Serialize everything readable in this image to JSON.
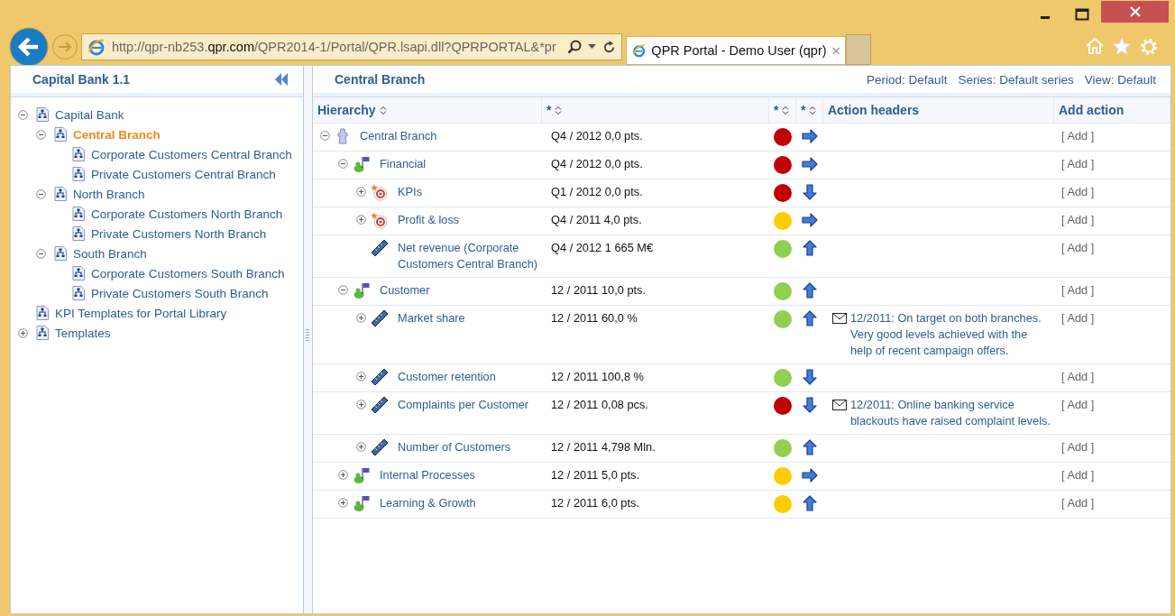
{
  "browser": {
    "url": "http://qpr-nb253.**qpr.com**/QPR2014-1/Portal/QPR.lsapi.dll?QPRPORTAL&*pr",
    "tab_title": "QPR Portal - Demo User (qpr)"
  },
  "sidebar": {
    "title": "Capital Bank 1.1",
    "tree": [
      {
        "label": "Capital Bank",
        "selected": false,
        "expanded": true,
        "children": [
          {
            "label": "Central Branch",
            "selected": true,
            "expanded": true,
            "children": [
              {
                "label": "Corporate Customers Central Branch",
                "selected": false
              },
              {
                "label": "Private Customers Central Branch",
                "selected": false
              }
            ]
          },
          {
            "label": "North Branch",
            "selected": false,
            "expanded": true,
            "children": [
              {
                "label": "Corporate Customers North Branch",
                "selected": false
              },
              {
                "label": "Private Customers North Branch",
                "selected": false
              }
            ]
          },
          {
            "label": "South Branch",
            "selected": false,
            "expanded": true,
            "children": [
              {
                "label": "Corporate Customers South Branch",
                "selected": false
              },
              {
                "label": "Private Customers South Branch",
                "selected": false
              }
            ]
          }
        ]
      },
      {
        "label": "KPI Templates for Portal Library",
        "selected": false
      },
      {
        "label": "Templates",
        "selected": false,
        "expanded": false
      }
    ]
  },
  "main": {
    "title": "Central Branch",
    "period": "Period: Default",
    "series": "Series: Default series",
    "view": "View: Default",
    "table": {
      "columns": [
        {
          "label": "Hierarchy",
          "sortable": true
        },
        {
          "label": "*",
          "sortable": true
        },
        {
          "label": "*",
          "sortable": true
        },
        {
          "label": "*",
          "sortable": true
        },
        {
          "label": "Action headers",
          "sortable": false
        },
        {
          "label": "Add action",
          "sortable": false
        }
      ],
      "rows": [
        {
          "name": "Central Branch",
          "kind": "scorecard",
          "expanded": true,
          "value": "Q4 / 2012 0,0 pts.",
          "color": "#c00000",
          "trend": {
            "kind": "right"
          },
          "add": "[ Add ]",
          "children": [
            {
              "name": "Financial",
              "kind": "perspective",
              "expanded": true,
              "value": "Q4 / 2012 0,0 pts.",
              "color": "#c00000",
              "trend": {
                "kind": "right"
              },
              "add": "[ Add ]",
              "children": [
                {
                  "name": "KPIs",
                  "kind": "goal",
                  "expanded": false,
                  "value": "Q1 / 2012 0,0 pts.",
                  "color": "#c00000",
                  "trend": {
                    "kind": "down"
                  },
                  "add": "[ Add ]"
                },
                {
                  "name": "Profit & loss",
                  "kind": "goal",
                  "expanded": false,
                  "value": "Q4 / 2011 4,0 pts.",
                  "color": "#ffcc00",
                  "trend": {
                    "kind": "right"
                  },
                  "add": "[ Add ]"
                },
                {
                  "name": "Net revenue (Corporate Customers Central Branch)",
                  "kind": "measure",
                  "value": "Q4 / 2012 1 665 M€",
                  "color": "#8fd14f",
                  "trend": {
                    "kind": "up"
                  },
                  "add": "[ Add ]"
                }
              ]
            },
            {
              "name": "Customer",
              "kind": "perspective",
              "expanded": true,
              "value": "12 / 2011 10,0 pts.",
              "color": "#8fd14f",
              "trend": {
                "kind": "up"
              },
              "add": "[ Add ]",
              "children": [
                {
                  "name": "Market share",
                  "kind": "measure",
                  "expanded": false,
                  "value": "12 / 2011 60,0 %",
                  "color": "#8fd14f",
                  "trend": {
                    "kind": "up"
                  },
                  "comment": "12/2011: On target on both branches. Very good levels achieved with the help of recent campaign offers.",
                  "add": "[ Add ]"
                },
                {
                  "name": "Customer retention",
                  "kind": "measure",
                  "expanded": false,
                  "value": "12 / 2011 100,8 %",
                  "color": "#8fd14f",
                  "trend": {
                    "kind": "down"
                  },
                  "add": "[ Add ]"
                },
                {
                  "name": "Complaints per Customer",
                  "kind": "measure",
                  "expanded": false,
                  "value": "12 / 2011 0,08 pcs.",
                  "color": "#c00000",
                  "trend": {
                    "kind": "down"
                  },
                  "comment": "12/2011: Online banking service blackouts have raised complaint levels.",
                  "add": "[ Add ]"
                },
                {
                  "name": "Number of Customers",
                  "kind": "measure",
                  "expanded": false,
                  "value": "12 / 2011 4,798 Mln.",
                  "color": "#8fd14f",
                  "trend": {
                    "kind": "up"
                  },
                  "add": "[ Add ]"
                }
              ]
            },
            {
              "name": "Internal Processes",
              "kind": "perspective",
              "expanded": false,
              "value": "12 / 2011 5,0 pts.",
              "color": "#ffcc00",
              "trend": {
                "kind": "right"
              },
              "add": "[ Add ]"
            },
            {
              "name": "Learning & Growth",
              "kind": "perspective",
              "expanded": false,
              "value": "12 / 2011 6,0 pts.",
              "color": "#ffcc00",
              "trend": {
                "kind": "up"
              },
              "add": "[ Add ]"
            }
          ]
        }
      ]
    }
  }
}
